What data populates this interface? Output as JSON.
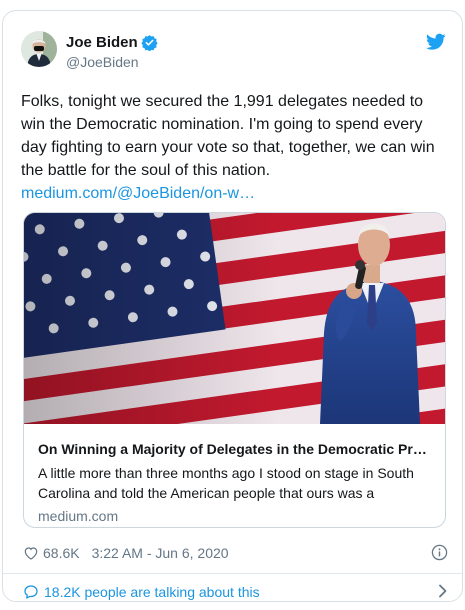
{
  "author": {
    "name": "Joe Biden",
    "handle": "@JoeBiden",
    "verified": true
  },
  "tweet": {
    "lines": [
      "Folks, tonight we secured the 1,991 delegates needed to",
      "win the Democratic nomination. I'm going to spend every",
      "day fighting to earn your vote so that, together, we can win",
      "the battle for the soul of this nation."
    ],
    "link": "medium.com/@JoeBiden/on-w…"
  },
  "card": {
    "title": "On Winning a Majority of Delegates in the Democratic Pr…",
    "description_lines": [
      "A little more than three months ago I stood on stage in South",
      "Carolina and told the American people that ours was a"
    ],
    "domain": "medium.com"
  },
  "meta": {
    "likes": "68.6K",
    "timestamp": "3:22 AM - Jun 6, 2020"
  },
  "conversation": {
    "label": "18.2K people are talking about this"
  },
  "colors": {
    "accent": "#1b95e0",
    "text": "#14171a",
    "muted": "#657786",
    "border": "#ccd6dd"
  },
  "icons": [
    "twitter-bird-icon",
    "verified-badge-icon",
    "heart-icon",
    "info-icon",
    "comment-bubble-icon",
    "chevron-right-icon"
  ]
}
